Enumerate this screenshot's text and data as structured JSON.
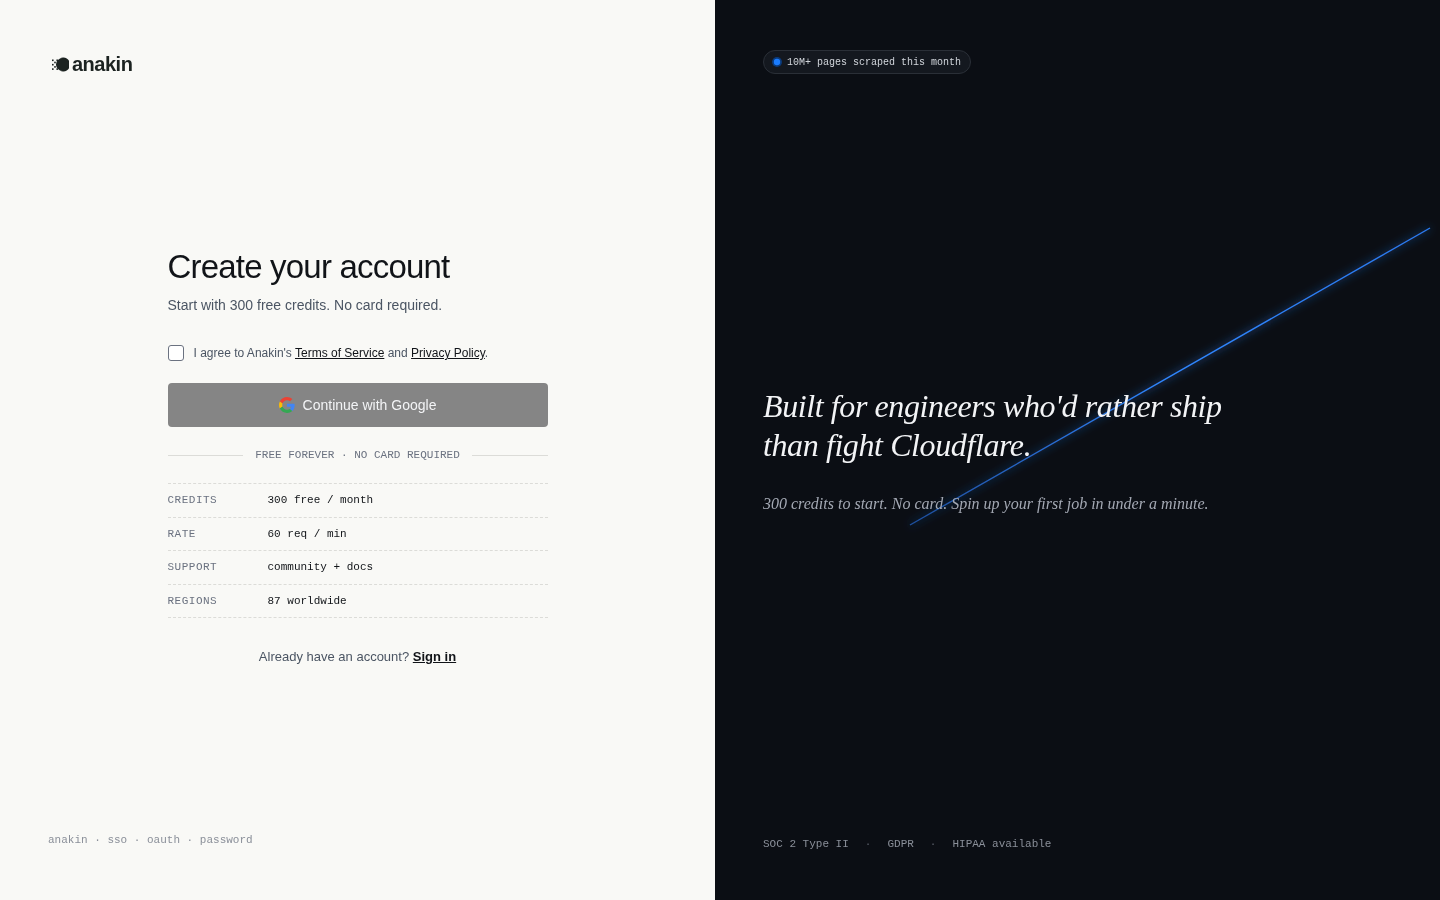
{
  "brand": {
    "name": "anakin"
  },
  "signup": {
    "title": "Create your account",
    "subtitle": "Start with 300 free credits. No card required.",
    "consent": {
      "checked": false,
      "prefix": "I agree to Anakin's",
      "terms_link": "Terms of Service",
      "conjunction": "and",
      "privacy_link": "Privacy Policy",
      "suffix": "."
    },
    "google_button": {
      "label": "Continue with Google",
      "disabled": true
    },
    "divider": "FREE FOREVER · NO CARD REQUIRED",
    "plan_rows": [
      {
        "label": "CREDITS",
        "value": "300 free / month"
      },
      {
        "label": "RATE",
        "value": "60 req / min"
      },
      {
        "label": "SUPPORT",
        "value": "community + docs"
      },
      {
        "label": "REGIONS",
        "value": "87 worldwide"
      }
    ],
    "signin": {
      "prompt": "Already have an account?",
      "link": "Sign in"
    }
  },
  "left_footer": "anakin · sso · oauth · password",
  "hero": {
    "badge": "10M+ pages scraped this month",
    "headline_lines": [
      "Built for engineers who'd rather ship",
      "than fight Cloudflare."
    ],
    "tagline": "300 credits to start. No card. Spin up your first job in under a minute.",
    "compliance": [
      {
        "kind": "item",
        "text": "SOC 2 Type II"
      },
      {
        "kind": "separator",
        "text": "·"
      },
      {
        "kind": "item",
        "text": "GDPR"
      },
      {
        "kind": "separator",
        "text": "·"
      },
      {
        "kind": "item",
        "text": "HIPAA available"
      }
    ]
  }
}
